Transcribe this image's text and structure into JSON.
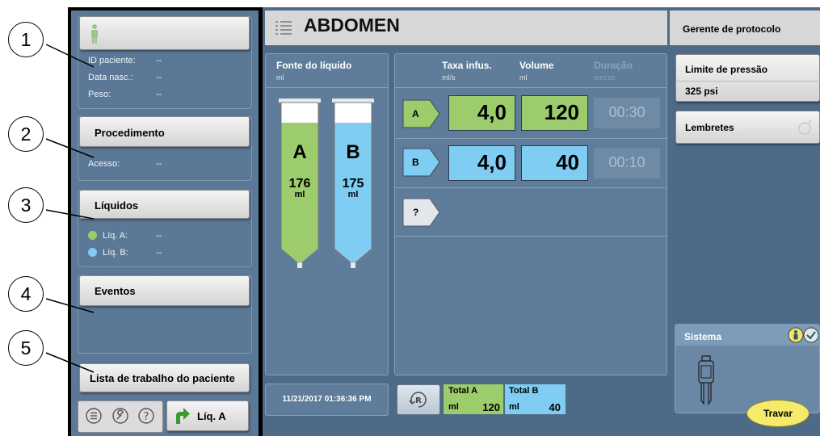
{
  "callouts": [
    "1",
    "2",
    "3",
    "4",
    "5"
  ],
  "patient": {
    "id_label": "ID paciente:",
    "id_value": "--",
    "dob_label": "Data nasc.:",
    "dob_value": "--",
    "weight_label": "Peso:",
    "weight_value": "--"
  },
  "procedure": {
    "button": "Procedimento",
    "access_label": "Acesso:",
    "access_value": "--"
  },
  "fluids": {
    "button": "Líquidos",
    "a_label": "Líq. A:",
    "a_value": "--",
    "b_label": "Líq. B:",
    "b_value": "--",
    "a_color": "#9ccc6c",
    "b_color": "#7fcdf2"
  },
  "events": {
    "button": "Eventos"
  },
  "worklist": {
    "button": "Lista de trabalho do paciente"
  },
  "bottom_tools": {
    "fluid_button": "Líq. A",
    "icons": [
      "list-icon",
      "wrench-icon",
      "help-icon",
      "arrow-icon"
    ]
  },
  "header": {
    "title": "ABDOMEN",
    "protocol_manager": "Gerente de protocolo"
  },
  "source": {
    "title": "Fonte do líquido",
    "unit": "ml",
    "syringe_a": {
      "letter": "A",
      "volume": "176",
      "unit": "ml"
    },
    "syringe_b": {
      "letter": "B",
      "volume": "175",
      "unit": "ml"
    }
  },
  "phases": {
    "headers": {
      "rate": "Taxa infus.",
      "rate_unit": "ml/s",
      "volume": "Volume",
      "volume_unit": "ml",
      "duration": "Duração",
      "duration_unit": "mm:ss"
    },
    "rows": [
      {
        "tag": "A",
        "rate": "4,0",
        "volume": "120",
        "duration": "00:30"
      },
      {
        "tag": "B",
        "rate": "4,0",
        "volume": "40",
        "duration": "00:10"
      }
    ],
    "add_tag": "?"
  },
  "footer": {
    "datetime": "11/21/2017 01:36:36 PM",
    "reset_icon": "R",
    "total_a": {
      "label": "Total A",
      "unit": "ml",
      "value": "120"
    },
    "total_b": {
      "label": "Total B",
      "unit": "ml",
      "value": "40"
    }
  },
  "right": {
    "pressure_label": "Limite de pressão",
    "pressure_value": "325 psi",
    "reminders": "Lembretes",
    "system": "Sistema",
    "lock_button": "Travar"
  }
}
